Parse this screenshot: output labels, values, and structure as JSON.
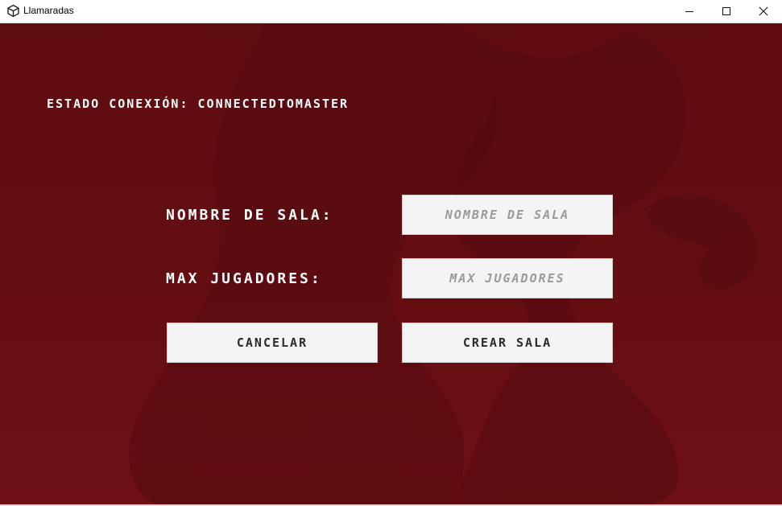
{
  "window": {
    "title": "Llamaradas",
    "app_icon": "unity-icon",
    "controls": {
      "minimize_icon": "minimize-icon",
      "maximize_icon": "maximize-icon",
      "close_icon": "close-icon"
    }
  },
  "status": {
    "text": "ESTADO CONEXIóN: CONNECTEDTOMASTER"
  },
  "form": {
    "room_name": {
      "label": "NOMBRE DE SALA:",
      "value": "",
      "placeholder": "NOMBRE DE SALA"
    },
    "max_players": {
      "label": "MAX JUGADORES:",
      "value": "",
      "placeholder": "MAX JUGADORES"
    }
  },
  "buttons": {
    "cancel_label": "CANCELAR",
    "create_label": "CREAR SALA"
  },
  "colors": {
    "background": "#6a0f13",
    "background_shape": "#560b10",
    "text": "#ffffff",
    "control_bg": "#f4f4f4",
    "placeholder": "#9a9a9a"
  }
}
